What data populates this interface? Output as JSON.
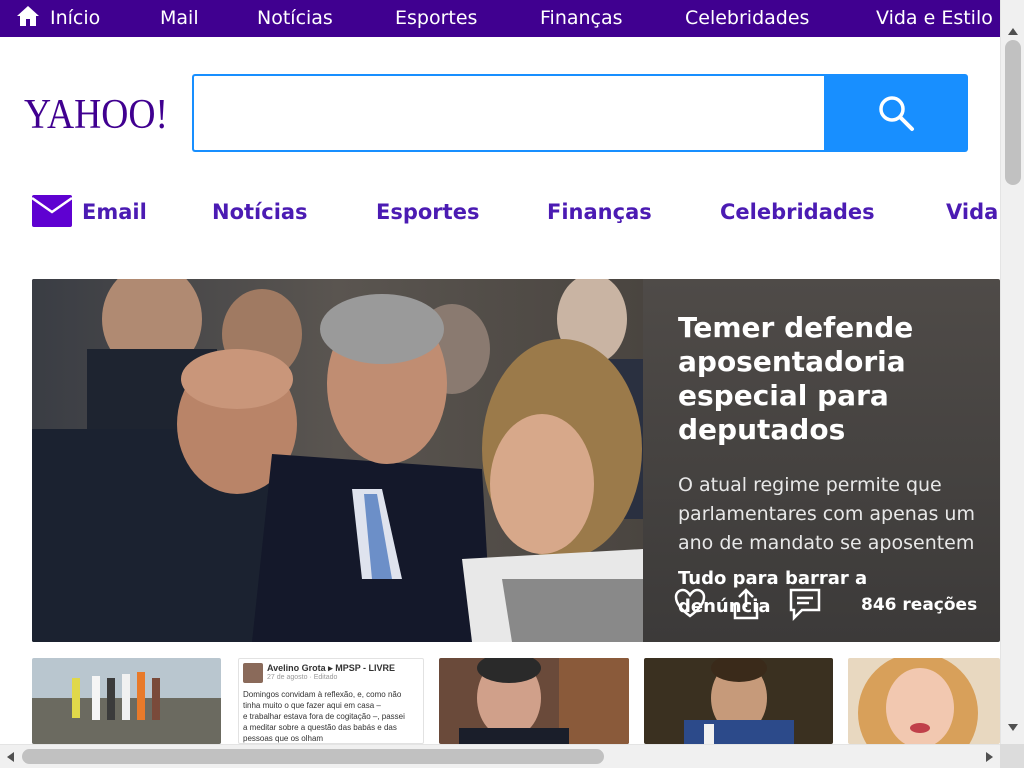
{
  "top_nav": {
    "items": [
      "Início",
      "Mail",
      "Notícias",
      "Esportes",
      "Finanças",
      "Celebridades",
      "Vida e Estilo"
    ],
    "home_icon": "home-icon",
    "background": "#400090"
  },
  "header": {
    "logo_text": "YAHOO!",
    "search": {
      "placeholder": "",
      "value": "",
      "button_icon": "search-icon"
    },
    "brand_color": "#400090",
    "accent": "#188fff"
  },
  "sub_nav": {
    "items": [
      "Email",
      "Notícias",
      "Esportes",
      "Finanças",
      "Celebridades",
      "Vida e Estilo"
    ],
    "email_icon": "mail-icon",
    "color": "#4b1bb3"
  },
  "hero": {
    "title_lines": [
      "Temer defende",
      "aposentadoria",
      "especial para",
      "deputados"
    ],
    "summary_lines": [
      "O atual regime permite que",
      "parlamentares com apenas um",
      "ano de mandato se aposentem"
    ],
    "related_lines": [
      "Tudo para barrar a",
      "denúncia"
    ],
    "reactions": "846 reações",
    "actions": [
      "heart-icon",
      "share-icon",
      "comment-icon"
    ]
  },
  "thumbnails": {
    "post": {
      "author": "Avelino Grota ▸ MPSP - LIVRE",
      "date": "27 de agosto · Editado",
      "body_lines": [
        "Domingos convidam à reflexão, e, como não",
        "tinha muito o que fazer aqui em casa –",
        "e trabalhar estava fora de cogitação –, passei",
        "a meditar sobre a questão das babás e das",
        "pessoas que os olham"
      ]
    }
  }
}
